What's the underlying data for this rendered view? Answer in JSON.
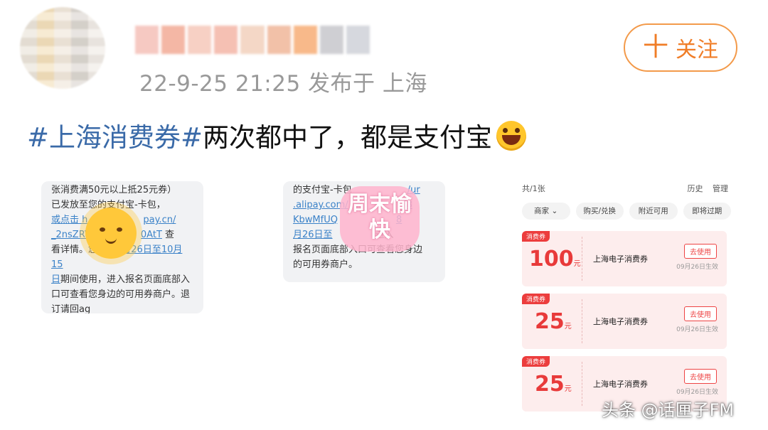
{
  "post": {
    "meta": "22-9-25 21:25  发布于 上海",
    "follow_label": "关注",
    "follow_plus": "十",
    "hashtag": "#上海消费券#",
    "text": "两次都中了，都是支付宝"
  },
  "screenshot1": {
    "lines": [
      "张消费满50元以上抵25元券）",
      "已发放至您的支付宝-卡包，",
      "或点击 h",
      "pay.cn/",
      "_2nsZRV",
      "0AtT",
      " 查",
      "看详情。您可在",
      "9月26日至10月15",
      "日",
      "期间使用，进入报名页面底部入",
      "口可查看您身边的可用券商户。退",
      "订请回ag"
    ]
  },
  "screenshot2": {
    "lines": [
      "的支付宝-卡包",
      "/ur",
      ".alipay.com/",
      "J8",
      "KbwMfUQ",
      "8",
      "月26日至",
      "进入",
      "报名页面底部入口可查看您身边",
      "的可用券商户。"
    ],
    "sticker": "周末愉快"
  },
  "wallet": {
    "count": "共/1张",
    "history": "历史",
    "manage": "管理",
    "filters": [
      "商家",
      "购买/兑换",
      "附近可用",
      "即将过期"
    ],
    "coupons": [
      {
        "tag": "消费券",
        "amount": "100",
        "unit": "元",
        "name": "上海电子消费券",
        "action": "去使用",
        "effective": "09月26日生效"
      },
      {
        "tag": "消费券",
        "amount": "25",
        "unit": "元",
        "name": "上海电子消费券",
        "action": "去使用",
        "effective": "09月26日生效"
      },
      {
        "tag": "消费券",
        "amount": "25",
        "unit": "元",
        "name": "上海电子消费券",
        "action": "去使用",
        "effective": "09月26日生效"
      }
    ]
  },
  "watermark": "头条 @话匣子FM"
}
